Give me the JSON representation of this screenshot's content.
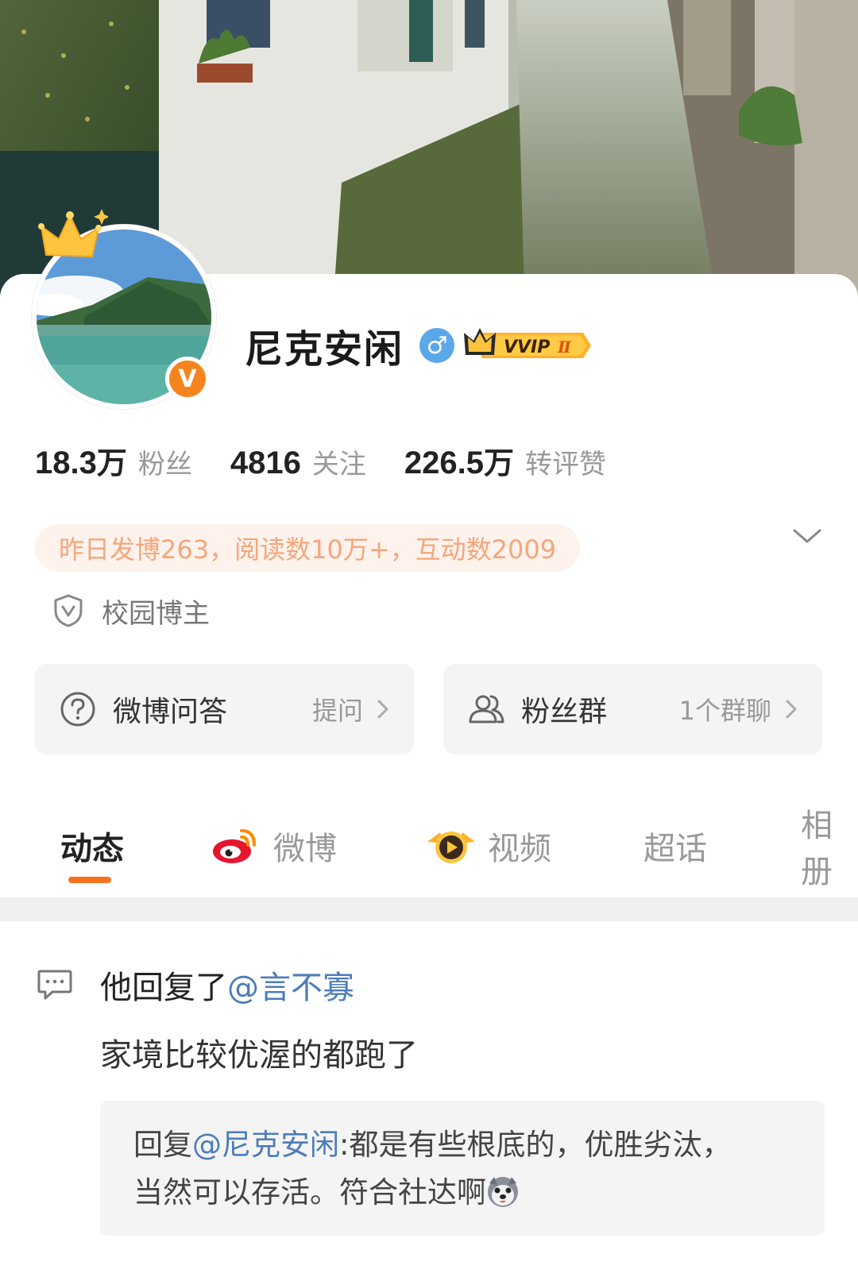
{
  "profile": {
    "name": "尼克安闲",
    "verified_badge": "V",
    "gender_symbol": "♂",
    "vip_label": "VVIP",
    "vip_level": "Ⅱ"
  },
  "stats": [
    {
      "number": "18.3",
      "unit": "万",
      "label": "粉丝"
    },
    {
      "number": "4816",
      "unit": "",
      "label": "关注"
    },
    {
      "number": "226.5",
      "unit": "万",
      "label": "转评赞"
    }
  ],
  "activity_summary": "昨日发博263，阅读数10万+，互动数2009",
  "campus_tag": "校园博主",
  "entries": {
    "qa": {
      "title": "微博问答",
      "action": "提问"
    },
    "fans_group": {
      "title": "粉丝群",
      "action": "1个群聊"
    }
  },
  "tabs": [
    {
      "label": "动态",
      "active": true
    },
    {
      "label": "微博",
      "active": false
    },
    {
      "label": "视频",
      "active": false
    },
    {
      "label": "超话",
      "active": false
    },
    {
      "label": "相册",
      "active": false
    }
  ],
  "post": {
    "action_prefix": "他回复了",
    "mention": "@言不寡",
    "text": "家境比较优渥的都跑了",
    "quote": {
      "prefix": "回复",
      "mention": "@尼克安闲",
      "line1_rest": ":都是有些根底的，优胜劣汰，",
      "line2": "当然可以存活。符合社达啊"
    }
  },
  "colors": {
    "accent": "#f5731f",
    "verified": "#f5841f",
    "mention": "#4d7db8",
    "gender": "#5aa7ea",
    "activity_text": "#f5a67b",
    "activity_bg": "#fdf2ec"
  },
  "icons": [
    "crown-icon",
    "gender-male-icon",
    "vvip-crown-icon",
    "chevron-down-icon",
    "shield-v-icon",
    "question-icon",
    "group-icon",
    "chevron-right-icon",
    "weibo-logo-icon",
    "video-play-icon",
    "comment-icon",
    "husky-emoji-icon"
  ]
}
